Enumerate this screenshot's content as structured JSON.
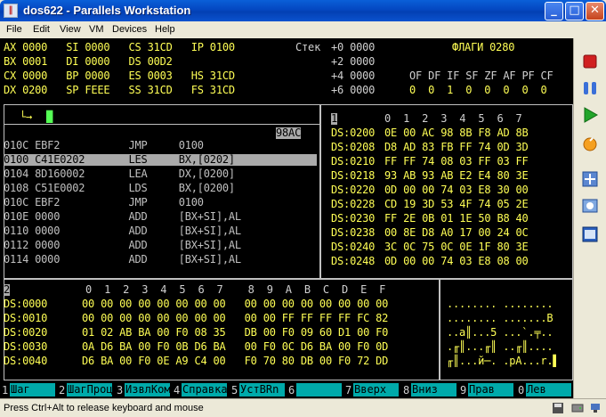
{
  "window": {
    "title": "dos622 - Parallels Workstation",
    "icon": "parallels-icon",
    "buttons": [
      "minimize-icon",
      "maximize-icon",
      "close-icon"
    ]
  },
  "menu": [
    "File",
    "Edit",
    "View",
    "VM",
    "Devices",
    "Help"
  ],
  "registers": {
    "row1": "AX 0000   SI 0000   CS 31CD   IP 0100",
    "row2": "BX 0001   DI 0000   DS 00D2",
    "row3": "CX 0000   BP 0000   ES 0003   HS 31CD",
    "row4": "DX 0200   SP FEEE   SS 31CD   FS 31CD"
  },
  "stack": {
    "label": "Стек",
    "rows": [
      "+0 0000",
      "+2 0000",
      "+4 0000",
      "+6 0000"
    ]
  },
  "flags": {
    "label": "ФЛАГИ 0280",
    "names": "OF DF IF SF ZF AF PF CF",
    "values": "0  0  1  0  0  0  0  0"
  },
  "command": {
    "prompt": "└→ ",
    "cursor": "█"
  },
  "disasm": {
    "tag": "98AC",
    "lines": [
      "010C EBF2           JMP     0100",
      "0100 C41E0202       LES     BX,[0202]",
      "0104 8D160002       LEA     DX,[0200]",
      "0108 C51E0002       LDS     BX,[0200]",
      "010C EBF2           JMP     0100",
      "010E 0000           ADD     [BX+SI],AL",
      "0110 0000           ADD     [BX+SI],AL",
      "0112 0000           ADD     [BX+SI],AL",
      "0114 0000           ADD     [BX+SI],AL"
    ],
    "selected": 1
  },
  "dump_right": {
    "header_num": "1",
    "header": "0  1  2  3  4  5  6  7",
    "rows": [
      {
        "addr": "DS:0200",
        "hex": "0E 00 AC 98 8B F8 AD 8B"
      },
      {
        "addr": "DS:0208",
        "hex": "D8 AD 83 FB FF 74 0D 3D"
      },
      {
        "addr": "DS:0210",
        "hex": "FF FF 74 08 03 FF 03 FF"
      },
      {
        "addr": "DS:0218",
        "hex": "93 AB 93 AB E2 E4 80 3E"
      },
      {
        "addr": "DS:0220",
        "hex": "0D 00 00 74 03 E8 30 00"
      },
      {
        "addr": "DS:0228",
        "hex": "CD 19 3D 53 4F 74 05 2E"
      },
      {
        "addr": "DS:0230",
        "hex": "FF 2E 0B 01 1E 50 B8 40"
      },
      {
        "addr": "DS:0238",
        "hex": "00 8E D8 A0 17 00 24 0C"
      },
      {
        "addr": "DS:0240",
        "hex": "3C 0C 75 0C 0E 1F 80 3E"
      },
      {
        "addr": "DS:0248",
        "hex": "0D 00 00 74 03 E8 08 00"
      }
    ]
  },
  "dump_bottom": {
    "header_num": "2",
    "header": "0  1  2  3  4  5  6  7    8  9  A  B  C  D  E  F",
    "rows": [
      {
        "addr": "DS:0000",
        "hex": "00 00 00 00 00 00 00 00   00 00 00 00 00 00 00 00",
        "ascii": "........ ........"
      },
      {
        "addr": "DS:0010",
        "hex": "00 00 00 00 00 00 00 00   00 00 FF FF FF FF FC 82",
        "ascii": "........ .......В"
      },
      {
        "addr": "DS:0020",
        "hex": "01 02 AB BA 00 F0 08 35   DB 00 F0 09 60 D1 00 F0",
        "ascii": "..а║...5 ...`.╤.."
      },
      {
        "addr": "DS:0030",
        "hex": "0A D6 BA 00 F0 0B D6 BA   00 F0 0C D6 BA 00 F0 0D",
        "ascii": ".╓║...╓║ ..╓║...."
      },
      {
        "addr": "DS:0040",
        "hex": "D6 BA 00 F0 0E A9 C4 00   F0 70 80 DB 00 F0 72 DD",
        "ascii": "╓║...й─. .pА...r.▌"
      }
    ]
  },
  "fkeys": [
    {
      "num": "1",
      "label": "Шаг"
    },
    {
      "num": "2",
      "label": "ШагПроц"
    },
    {
      "num": "3",
      "label": "ИзвлКом"
    },
    {
      "num": "4",
      "label": "Справка"
    },
    {
      "num": "5",
      "label": "УстBRn"
    },
    {
      "num": "6",
      "label": ""
    },
    {
      "num": "7",
      "label": "Вверх"
    },
    {
      "num": "8",
      "label": "Вниз"
    },
    {
      "num": "9",
      "label": "Прав"
    },
    {
      "num": "0",
      "label": "Лев"
    }
  ],
  "toolbar": [
    "stop-icon",
    "pause-icon",
    "play-icon",
    "reset-icon",
    "fullscreen-icon",
    "screenshot-icon",
    "window-icon"
  ],
  "status": {
    "text": "Press Ctrl+Alt to release keyboard and mouse",
    "icons": [
      "floppy-icon",
      "hdd-icon",
      "network-icon"
    ]
  },
  "colors": {
    "screen_bg": "#000000",
    "text": "#c0c0c0",
    "highlight": "#ffff55",
    "fkey_bg": "#00aaaa",
    "selection_bg": "#aaaaaa"
  }
}
